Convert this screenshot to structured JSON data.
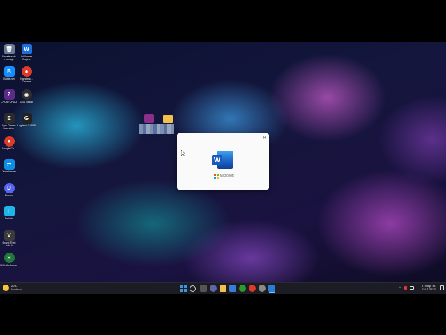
{
  "desktop": {
    "icons": [
      {
        "label": "Papelera de reciclaje",
        "glyph": "🗑",
        "color": "#6a7a90"
      },
      {
        "label": "Wallpaper Engine",
        "glyph": "W",
        "color": "#1e6fd9"
      },
      {
        "label": "Battle.net",
        "glyph": "B",
        "color": "#148eff"
      },
      {
        "label": "Navaleno - Chrome",
        "glyph": "●",
        "color": "#dd3a2a"
      },
      {
        "label": "CPUID CPU-Z",
        "glyph": "Z",
        "color": "#5b2b8a"
      },
      {
        "label": "OBS Studio",
        "glyph": "◉",
        "color": "#302e31"
      },
      {
        "label": "Epic Games Launcher",
        "glyph": "E",
        "color": "#2a2a2a"
      },
      {
        "label": "Logitech G HUB",
        "glyph": "G",
        "color": "#222"
      },
      {
        "label": "Google Ch...",
        "glyph": "●",
        "color": "#dd3a2a"
      },
      {
        "label": "TeamViewer",
        "glyph": "⇄",
        "color": "#0e8ee9"
      },
      {
        "label": "Discord",
        "glyph": "D",
        "color": "#5865f2"
      },
      {
        "label": "Fortnite",
        "glyph": "F",
        "color": "#1fb5e8"
      },
      {
        "label": "Grand Theft Auto V",
        "glyph": "V",
        "color": "#3b3b3b"
      },
      {
        "label": "MSI Afterburner",
        "glyph": "✕",
        "color": "#1f7a3a"
      }
    ],
    "loose_icons": [
      {
        "name": "winrar-icon",
        "color": "#8b2f8b"
      },
      {
        "name": "folder-icon",
        "color": "#f3c14b"
      }
    ]
  },
  "splash": {
    "minimize_glyph": "—",
    "close_glyph": "✕",
    "word_letter": "W",
    "brand": "Microsoft",
    "ms_colors": [
      "#f25022",
      "#7fba00",
      "#00a4ef",
      "#ffb900"
    ]
  },
  "taskbar": {
    "weather_temp": "20°C",
    "weather_desc": "Nublado",
    "tray_time": "07:05 p. m.",
    "tray_date": "12/11/2022",
    "apps": [
      {
        "name": "start-button",
        "color": "#3a96dd"
      },
      {
        "name": "search-icon",
        "color": "#d0d0d0"
      },
      {
        "name": "task-view-icon",
        "color": "#b0b0b0"
      },
      {
        "name": "chat-icon",
        "color": "#6264a7"
      },
      {
        "name": "file-explorer-icon",
        "color": "#f3c14b"
      },
      {
        "name": "store-icon",
        "color": "#3a7bd5"
      },
      {
        "name": "xbox-icon",
        "color": "#2c9a2c"
      },
      {
        "name": "chrome-icon",
        "color": "#dd3a2a"
      },
      {
        "name": "settings-icon",
        "color": "#8a8a8a"
      },
      {
        "name": "word-icon",
        "color": "#2b7cd3"
      }
    ]
  }
}
